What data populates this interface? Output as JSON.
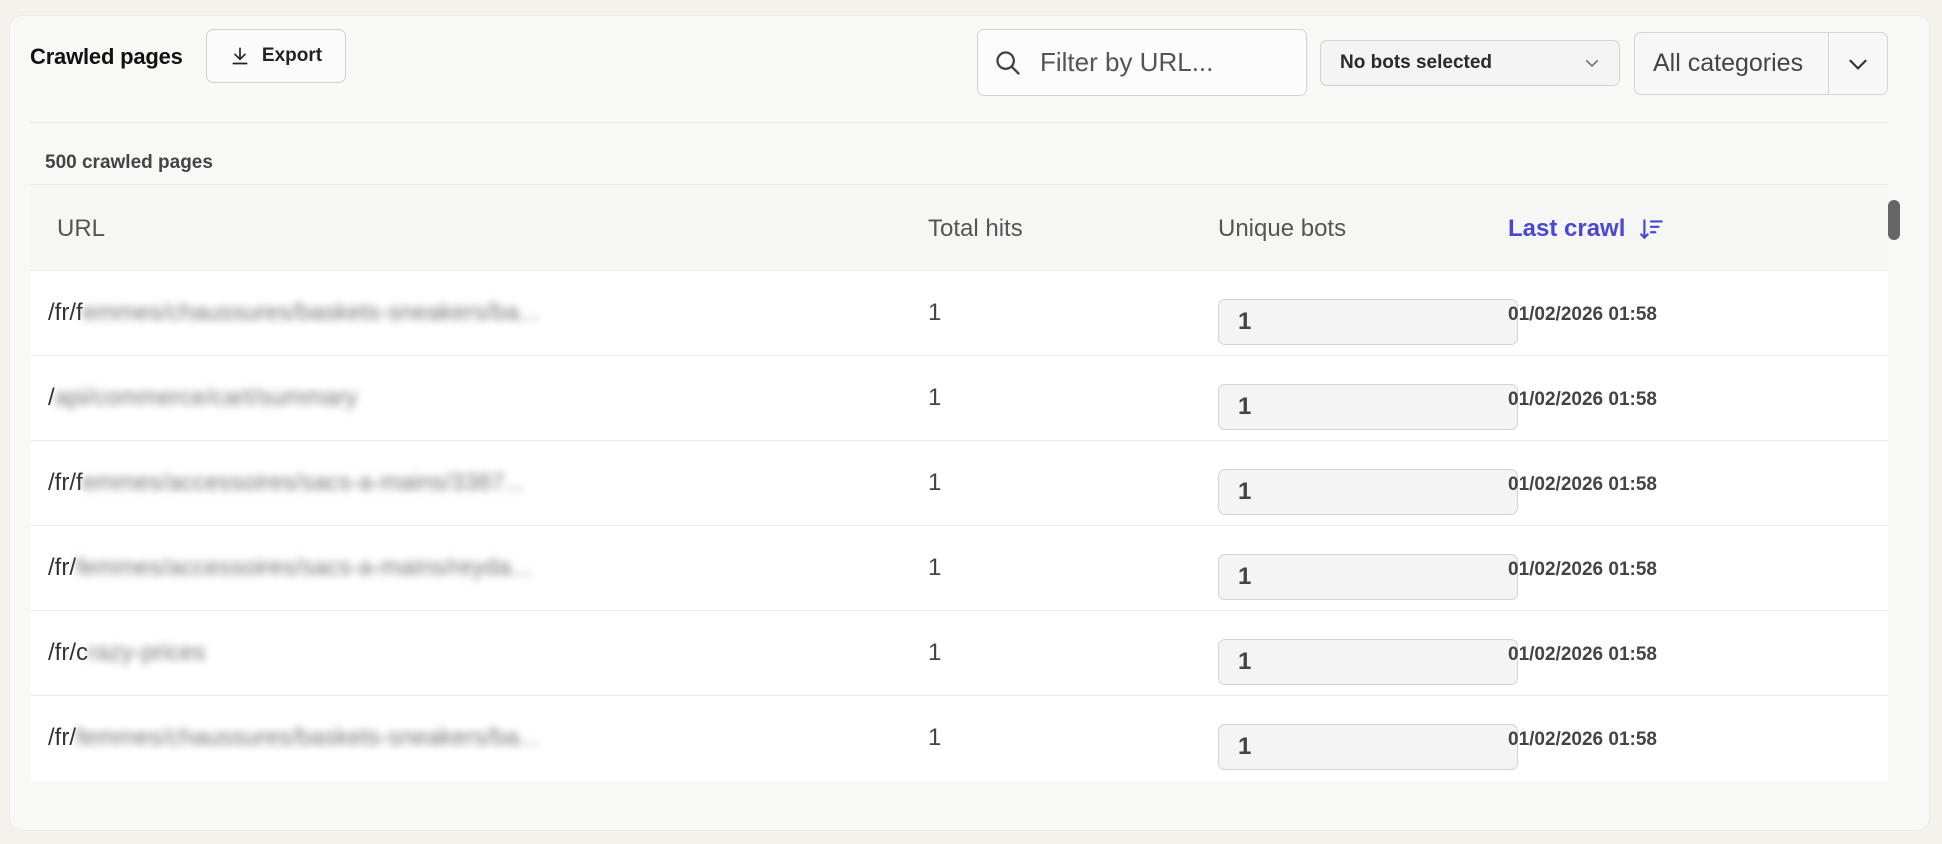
{
  "header": {
    "title": "Crawled pages",
    "export_label": "Export",
    "search_placeholder": "Filter by URL...",
    "bots_select": "No bots selected",
    "categories_select": "All categories"
  },
  "summary": {
    "count_text": "500 crawled pages"
  },
  "table": {
    "columns": {
      "url": "URL",
      "total_hits": "Total hits",
      "unique_bots": "Unique bots",
      "last_crawl": "Last crawl"
    },
    "sort": {
      "column": "last_crawl",
      "direction": "desc"
    },
    "rows": [
      {
        "url_prefix": "/fr/f",
        "url_hidden": "emmes/chaussures/baskets-sneakers/ba...",
        "total_hits": "1",
        "unique_bots": "1",
        "last_crawl": "01/02/2026 01:58"
      },
      {
        "url_prefix": "/",
        "url_hidden": "api/commerce/cart/summary",
        "total_hits": "1",
        "unique_bots": "1",
        "last_crawl": "01/02/2026 01:58"
      },
      {
        "url_prefix": "/fr/f",
        "url_hidden": "emmes/accessoires/sacs-a-mains/3387...",
        "total_hits": "1",
        "unique_bots": "1",
        "last_crawl": "01/02/2026 01:58"
      },
      {
        "url_prefix": "/fr/",
        "url_hidden": "femmes/accessoires/sacs-a-mains/reyda...",
        "total_hits": "1",
        "unique_bots": "1",
        "last_crawl": "01/02/2026 01:58"
      },
      {
        "url_prefix": "/fr/c",
        "url_hidden": "razy-prices",
        "total_hits": "1",
        "unique_bots": "1",
        "last_crawl": "01/02/2026 01:58"
      },
      {
        "url_prefix": "/fr/",
        "url_hidden": "femmes/chaussures/baskets-sneakers/ba...",
        "total_hits": "1",
        "unique_bots": "1",
        "last_crawl": "01/02/2026 01:58"
      }
    ]
  },
  "colors": {
    "accent": "#4b47d6",
    "background": "#f3f2ec",
    "panel": "#f8f8f7"
  },
  "icons": {
    "export": "download-icon",
    "search": "search-icon",
    "dropdown": "chevron-down-icon",
    "sort": "sort-descending-icon"
  }
}
